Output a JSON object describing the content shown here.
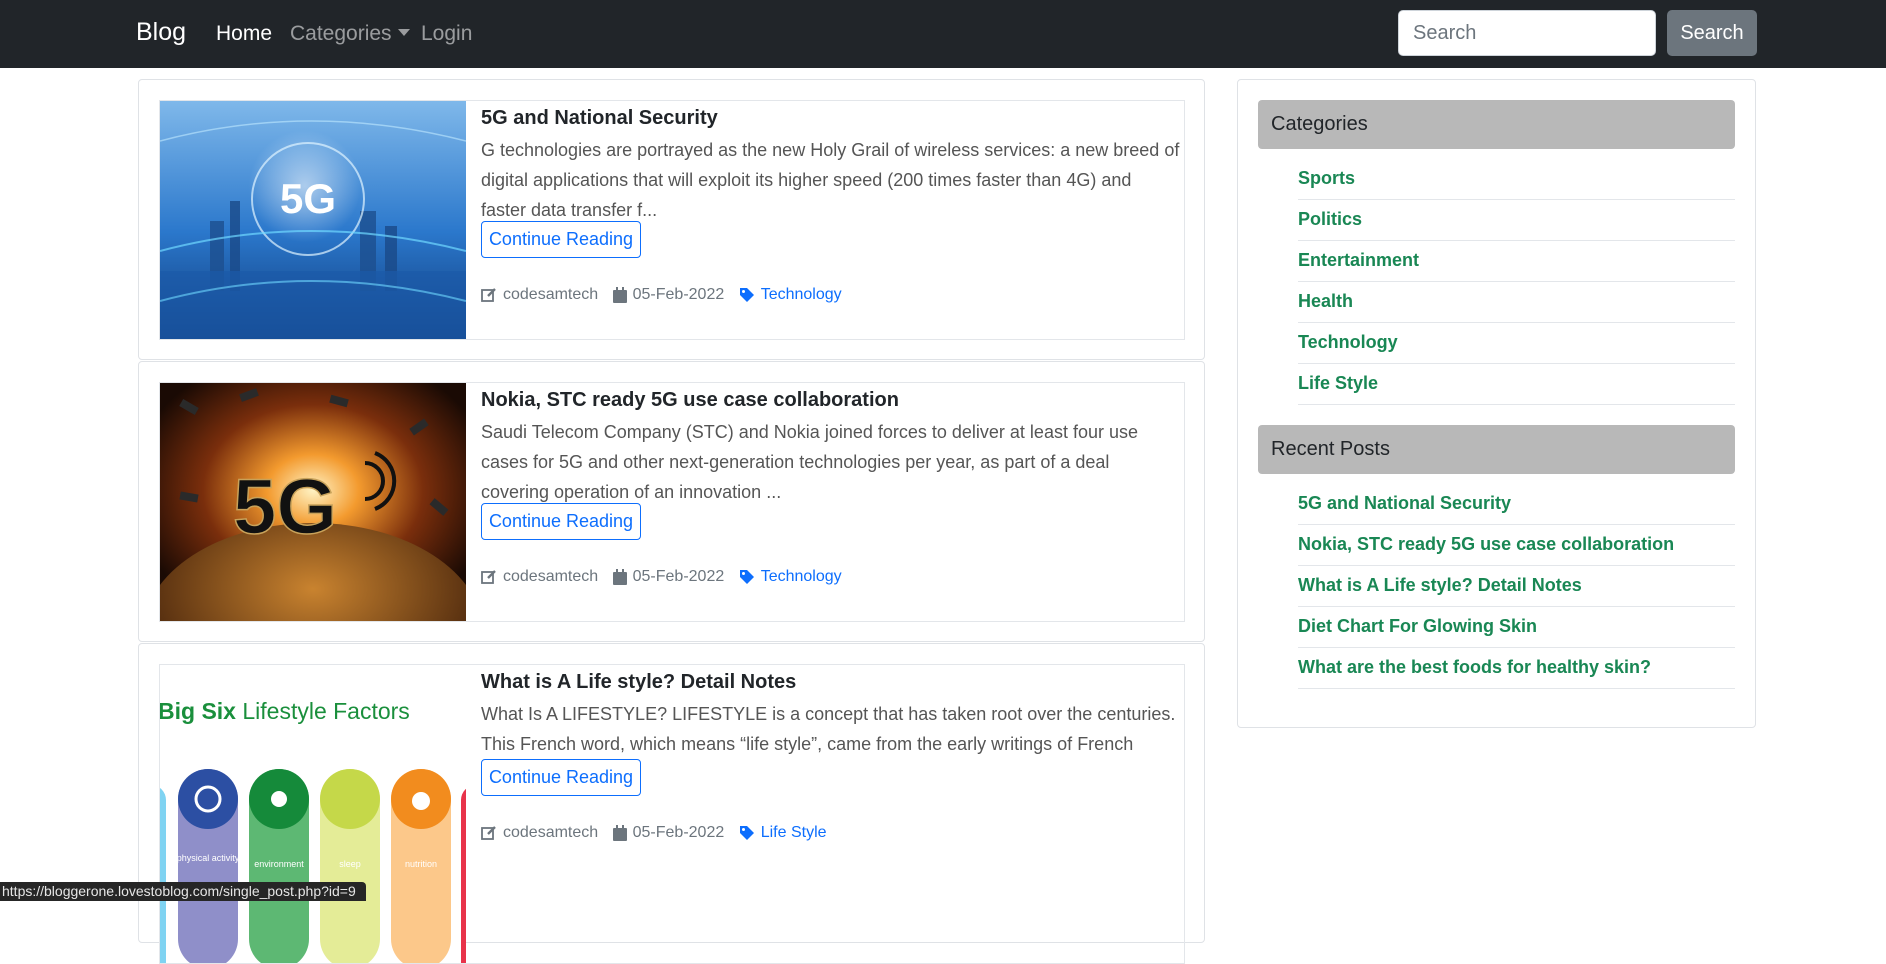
{
  "nav": {
    "brand": "Blog",
    "home": "Home",
    "categories": "Categories",
    "login": "Login",
    "search_placeholder": "Search",
    "search_button": "Search"
  },
  "posts": [
    {
      "title": "5G and National Security",
      "excerpt": "G technologies are portrayed as the new Holy Grail of wireless services: a new breed of digital applications that will exploit its higher speed (200 times faster than 4G) and faster data transfer f...",
      "button": "Continue Reading",
      "author": "codesamtech",
      "date": "05-Feb-2022",
      "category": "Technology",
      "image_text": "5G"
    },
    {
      "title": "Nokia, STC ready 5G use case collaboration",
      "excerpt": "Saudi Telecom Company (STC) and Nokia joined forces to deliver at least four use cases for 5G and other next-generation technologies per year, as part of a deal covering operation of an innovation ...",
      "button": "Continue Reading",
      "author": "codesamtech",
      "date": "05-Feb-2022",
      "category": "Technology",
      "image_text": "5G"
    },
    {
      "title": "What is A Life style? Detail Notes",
      "excerpt": "What Is A LIFESTYLE? LIFESTYLE is a concept that has taken root over the centuries. This French word, which means “life style”, came from the early writings of French physic...",
      "button": "Continue Reading",
      "author": "codesamtech",
      "date": "05-Feb-2022",
      "category": "Life Style",
      "image_heading_bold": "Big Six",
      "image_heading_rest": " Lifestyle Factors",
      "image_labels": [
        "physical activity",
        "environment",
        "sleep",
        "nutrition"
      ]
    }
  ],
  "sidebar": {
    "categories_title": "Categories",
    "categories": [
      "Sports",
      "Politics",
      "Entertainment",
      "Health",
      "Technology",
      "Life Style"
    ],
    "recent_title": "Recent Posts",
    "recent": [
      "5G and National Security",
      "Nokia, STC ready 5G use case collaboration",
      "What is A Life style? Detail Notes",
      "Diet Chart For Glowing Skin",
      "What are the best foods for healthy skin?"
    ]
  },
  "status_url": "https://bloggerone.lovestoblog.com/single_post.php?id=9",
  "colors": {
    "navbar": "#212529",
    "link_blue": "#0d6efd",
    "sidebar_link_green": "#198754",
    "sidebar_header": "#b8b8b8"
  }
}
